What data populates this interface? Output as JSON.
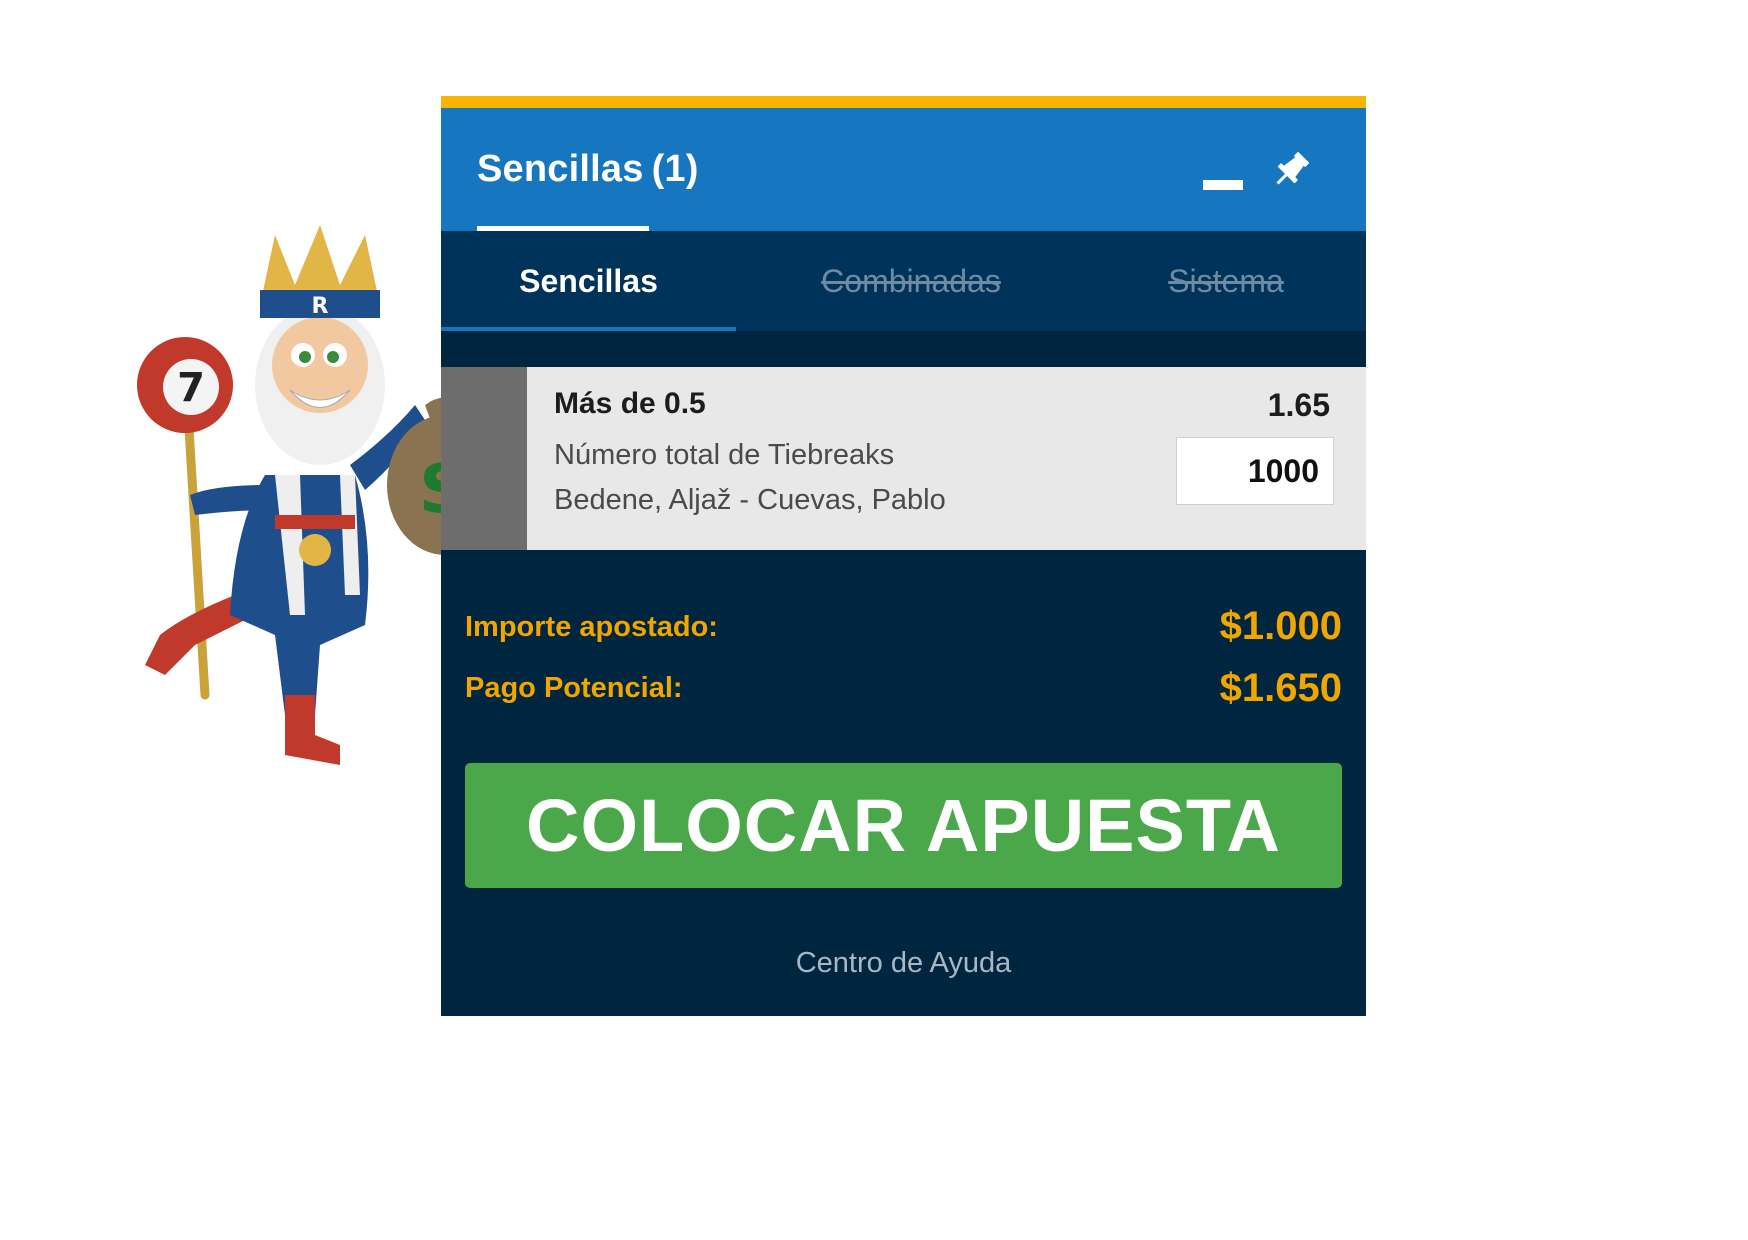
{
  "header": {
    "title": "Sencillas",
    "count": "(1)"
  },
  "tabs": [
    {
      "label": "Sencillas",
      "state": "active"
    },
    {
      "label": "Combinadas",
      "state": "disabled"
    },
    {
      "label": "Sistema",
      "state": "disabled"
    }
  ],
  "bet": {
    "selection": "Más de 0.5",
    "odds": "1.65",
    "market": "Número total de Tiebreaks",
    "event": "Bedene, Aljaž - Cuevas, Pablo",
    "stake": "1000"
  },
  "summary": {
    "importe_label": "Importe apostado:",
    "importe_value": "$1.000",
    "pago_label": "Pago Potencial:",
    "pago_value": "$1.650"
  },
  "place_bet_label": "COLOCAR APUESTA",
  "help_link": "Centro de Ayuda",
  "mascot": {
    "ball_number": "7",
    "crown_letter": "R",
    "bag_symbol": "$"
  },
  "colors": {
    "top_accent": "#f7b500",
    "header_blue": "#1676c0",
    "tabs_navy": "#00335a",
    "panel_navy": "#00263f",
    "summary_gold": "#f0a500",
    "button_green": "#4ba84a"
  },
  "icons": [
    "minimize-icon",
    "pin-icon"
  ]
}
